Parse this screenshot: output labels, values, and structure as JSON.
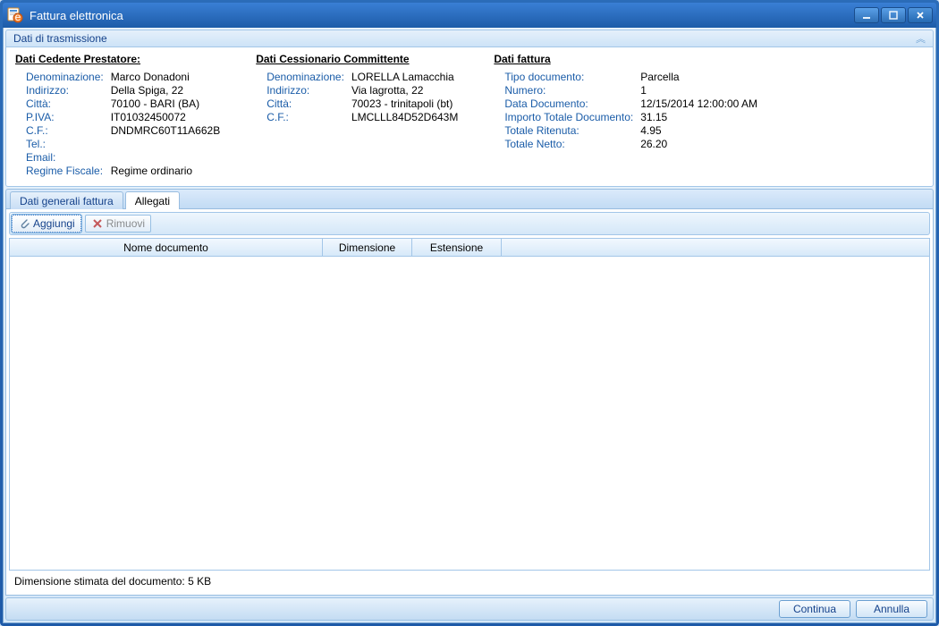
{
  "window": {
    "title": "Fattura elettronica"
  },
  "transmission_panel": {
    "title": "Dati di trasmissione"
  },
  "supplier": {
    "section_title": "Dati Cedente Prestatore:",
    "labels": {
      "denominazione": "Denominazione:",
      "indirizzo": "Indirizzo:",
      "citta": "Città:",
      "piva": "P.IVA:",
      "cf": "C.F.:",
      "tel": "Tel.:",
      "email": "Email:",
      "regime": "Regime Fiscale:"
    },
    "values": {
      "denominazione": "Marco Donadoni",
      "indirizzo": "Della Spiga, 22",
      "citta": "70100 - BARI (BA)",
      "piva": "IT01032450072",
      "cf": "DNDMRC60T11A662B",
      "tel": "",
      "email": "",
      "regime": "Regime ordinario"
    }
  },
  "customer": {
    "section_title": "Dati Cessionario Committente",
    "labels": {
      "denominazione": "Denominazione:",
      "indirizzo": "Indirizzo:",
      "citta": "Città:",
      "cf": "C.F.:"
    },
    "values": {
      "denominazione": "LORELLA Lamacchia",
      "indirizzo": "Via lagrotta, 22",
      "citta": "70023 - trinitapoli (bt)",
      "cf": "LMCLLL84D52D643M"
    }
  },
  "invoice": {
    "section_title": "Dati fattura",
    "labels": {
      "tipo": "Tipo documento:",
      "numero": "Numero:",
      "data": "Data Documento:",
      "importo": "Importo Totale Documento:",
      "ritenuta": "Totale Ritenuta:",
      "netto": "Totale Netto:"
    },
    "values": {
      "tipo": "Parcella",
      "numero": "1",
      "data": "12/15/2014 12:00:00 AM",
      "importo": "31.15",
      "ritenuta": "4.95",
      "netto": "26.20"
    }
  },
  "tabs": {
    "general": "Dati generali fattura",
    "attachments": "Allegati"
  },
  "toolbar": {
    "add": "Aggiungi",
    "remove": "Rimuovi"
  },
  "grid": {
    "col_name": "Nome documento",
    "col_size": "Dimensione",
    "col_ext": "Estensione"
  },
  "footer": {
    "estimated": "Dimensione stimata del documento: 5 KB"
  },
  "actions": {
    "continue": "Continua",
    "cancel": "Annulla"
  }
}
